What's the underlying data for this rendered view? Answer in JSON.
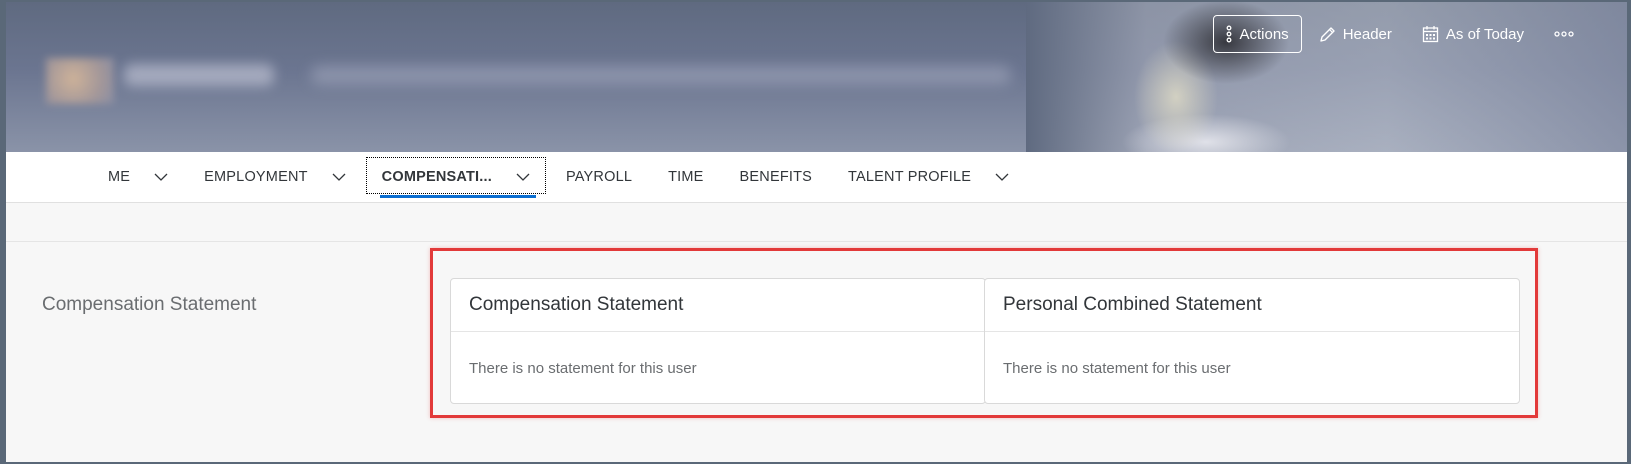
{
  "header": {
    "actions_label": "Actions",
    "header_label": "Header",
    "as_of_label": "As of Today"
  },
  "tabs": [
    {
      "label": "ME",
      "has_menu": true
    },
    {
      "label": "EMPLOYMENT",
      "has_menu": true
    },
    {
      "label": "COMPENSATI...",
      "has_menu": true,
      "selected": true
    },
    {
      "label": "PAYROLL",
      "has_menu": false
    },
    {
      "label": "TIME",
      "has_menu": false
    },
    {
      "label": "BENEFITS",
      "has_menu": false
    },
    {
      "label": "TALENT PROFILE",
      "has_menu": true
    }
  ],
  "section": {
    "title": "Compensation Statement",
    "cards": [
      {
        "title": "Compensation Statement",
        "message": "There is no statement for this user"
      },
      {
        "title": "Personal Combined Statement",
        "message": "There is no statement for this user"
      }
    ]
  },
  "colors": {
    "accent": "#0a6ed1",
    "highlight": "#e23a3a"
  }
}
